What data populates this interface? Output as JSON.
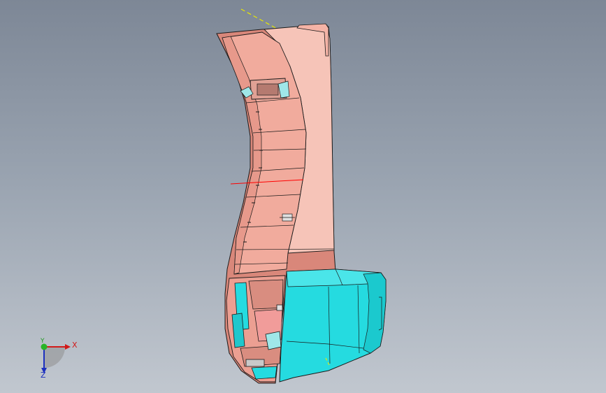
{
  "viewport": {
    "background_top": "#7d8796",
    "background_bottom": "#c1c7cf"
  },
  "model": {
    "shell_color": "#f2aea0",
    "shell_shadow_color": "#d9877a",
    "insert_color": "#25dbe0",
    "edge_color": "#1a1a1a",
    "reference_plane_color": "#ffff00",
    "reference_axis_color": "#ff0000"
  },
  "triad": {
    "x_label": "X",
    "y_label": "Y",
    "z_label": "Z",
    "x_color": "#d21a1a",
    "y_color": "#1e9a1e",
    "z_color": "#1c2fbf"
  }
}
